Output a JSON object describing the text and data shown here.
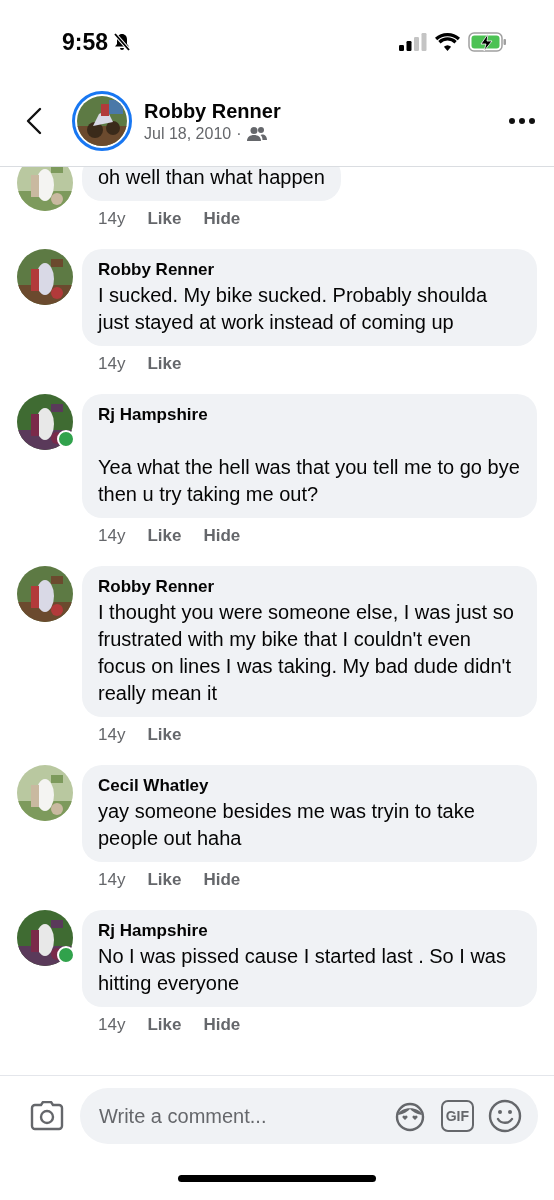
{
  "status_bar": {
    "time": "9:58",
    "silent": true
  },
  "header": {
    "name": "Robby Renner",
    "date": "Jul 18, 2010",
    "separator": "·"
  },
  "comments": [
    {
      "online": false,
      "text": "oh well than what happen",
      "time": "14y",
      "actions": [
        "Like",
        "Hide"
      ]
    },
    {
      "name": "Robby Renner",
      "online": false,
      "text": "I sucked. My bike sucked. Probably shoulda just stayed at work instead of coming up",
      "time": "14y",
      "actions": [
        "Like"
      ]
    },
    {
      "name": "Rj Hampshire",
      "online": true,
      "text": "\nYea what the hell was that you tell me to go bye then u try taking me out?",
      "time": "14y",
      "actions": [
        "Like",
        "Hide"
      ]
    },
    {
      "name": "Robby Renner",
      "online": false,
      "text": "I thought you were someone else, I was just so frustrated with my bike that I couldn't even focus on lines I was taking. My bad dude didn't really mean it",
      "time": "14y",
      "actions": [
        "Like"
      ]
    },
    {
      "name": "Cecil Whatley",
      "online": false,
      "text": "yay someone besides me was tryin to take people out haha",
      "time": "14y",
      "actions": [
        "Like",
        "Hide"
      ]
    },
    {
      "name": "Rj Hampshire",
      "online": true,
      "text": "No I was pissed cause I started last . So I was hitting everyone",
      "time": "14y",
      "actions": [
        "Like",
        "Hide"
      ]
    }
  ],
  "composer": {
    "placeholder": "Write a comment...",
    "gif_label": "GIF"
  }
}
